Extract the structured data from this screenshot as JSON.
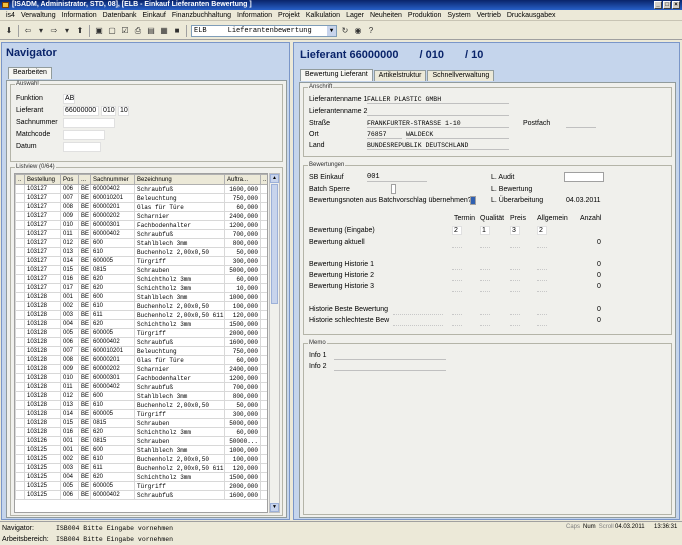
{
  "window": {
    "title": "[ISADM, Administrator, STD, 08], [ELB - Einkauf Lieferanten Bewertung ]"
  },
  "menu": [
    "is4",
    "Verwaltung",
    "Information",
    "Datenbank",
    "Einkauf",
    "Finanzbuchhaltung",
    "Information",
    "Projekt",
    "Kalkulation",
    "Lager",
    "Neuheiten",
    "Produktion",
    "System",
    "Vertrieb",
    "Druckausgabex"
  ],
  "toolbar": {
    "module_code": "ELB",
    "module_name": "Lieferantenbewertung"
  },
  "navigator": {
    "title": "Navigator",
    "tab": "Bearbeiten",
    "auswahl_label": "Auswahl",
    "fields": {
      "funktion_label": "Funktion",
      "funktion_value": "AB",
      "lieferant_label": "Lieferant",
      "lieferant_value": "66000000",
      "lieferant_pos": "010",
      "lieferant_seq": "10",
      "sachnummer_label": "Sachnummer",
      "matchcode_label": "Matchcode",
      "datum_label": "Datum"
    },
    "list_label": "Listview (0/64)",
    "columns": [
      "..",
      "Bestellung",
      "Pos",
      "...",
      "Sachnummer",
      "Bezeichnung",
      "Auftra...",
      ".."
    ],
    "rows": [
      [
        "103127",
        "006",
        "BE",
        "60000402",
        "Schraubfuß",
        "1600,000"
      ],
      [
        "103127",
        "007",
        "BE",
        "600010201",
        "Beleuchtung",
        "750,000"
      ],
      [
        "103127",
        "008",
        "BE",
        "60000201",
        "Glas für Türe",
        "60,000"
      ],
      [
        "103127",
        "009",
        "BE",
        "60000202",
        "Scharnier",
        "2400,000"
      ],
      [
        "103127",
        "010",
        "BE",
        "60000301",
        "Fachbodenhalter",
        "1200,000"
      ],
      [
        "103127",
        "011",
        "BE",
        "60000402",
        "Schraubfuß",
        "700,000"
      ],
      [
        "103127",
        "012",
        "BE",
        "600",
        "Stahlblech 3mm",
        "800,000"
      ],
      [
        "103127",
        "013",
        "BE",
        "610",
        "Buchenholz 2,00x0,50",
        "50,000"
      ],
      [
        "103127",
        "014",
        "BE",
        "600005",
        "Türgriff",
        "300,000"
      ],
      [
        "103127",
        "015",
        "BE",
        "0815",
        "Schrauben",
        "5000,000"
      ],
      [
        "103127",
        "016",
        "BE",
        "620",
        "Schichtholz 3mm",
        "60,000"
      ],
      [
        "103127",
        "017",
        "BE",
        "620",
        "Schichtholz 3mm",
        "10,000"
      ],
      [
        "103128",
        "001",
        "BE",
        "600",
        "Stahlblech 3mm",
        "1000,000"
      ],
      [
        "103128",
        "002",
        "BE",
        "610",
        "Buchenholz 2,00x0,50",
        "100,000"
      ],
      [
        "103128",
        "003",
        "BE",
        "611",
        "Buchenholz 2,00x0,50  611",
        "120,000"
      ],
      [
        "103128",
        "004",
        "BE",
        "620",
        "Schichtholz 3mm",
        "1500,000"
      ],
      [
        "103128",
        "005",
        "BE",
        "600005",
        "Türgriff",
        "2000,000"
      ],
      [
        "103128",
        "006",
        "BE",
        "60000402",
        "Schraubfuß",
        "1600,000"
      ],
      [
        "103128",
        "007",
        "BE",
        "600010201",
        "Beleuchtung",
        "750,000"
      ],
      [
        "103128",
        "008",
        "BE",
        "60000201",
        "Glas für Türe",
        "60,000"
      ],
      [
        "103128",
        "009",
        "BE",
        "60000202",
        "Scharnier",
        "2400,000"
      ],
      [
        "103128",
        "010",
        "BE",
        "60000301",
        "Fachbodenhalter",
        "1200,000"
      ],
      [
        "103128",
        "011",
        "BE",
        "60000402",
        "Schraubfuß",
        "700,000"
      ],
      [
        "103128",
        "012",
        "BE",
        "600",
        "Stahlblech 3mm",
        "800,000"
      ],
      [
        "103128",
        "013",
        "BE",
        "610",
        "Buchenholz 2,00x0,50",
        "50,000"
      ],
      [
        "103128",
        "014",
        "BE",
        "600005",
        "Türgriff",
        "300,000"
      ],
      [
        "103128",
        "015",
        "BE",
        "0815",
        "Schrauben",
        "5000,000"
      ],
      [
        "103128",
        "016",
        "BE",
        "620",
        "Schichtholz 3mm",
        "60,000"
      ],
      [
        "103126",
        "001",
        "BE",
        "0815",
        "Schrauben",
        "50000..."
      ],
      [
        "103125",
        "001",
        "BE",
        "600",
        "Stahlblech 3mm",
        "1000,000"
      ],
      [
        "103125",
        "002",
        "BE",
        "610",
        "Buchenholz 2,00x0,50",
        "100,000"
      ],
      [
        "103125",
        "003",
        "BE",
        "611",
        "Buchenholz 2,00x0,50  611",
        "120,000"
      ],
      [
        "103125",
        "004",
        "BE",
        "620",
        "Schichtholz 3mm",
        "1500,000"
      ],
      [
        "103125",
        "005",
        "BE",
        "600005",
        "Türgriff",
        "2000,000"
      ],
      [
        "103125",
        "006",
        "BE",
        "60000402",
        "Schraubfuß",
        "1600,000"
      ]
    ]
  },
  "detail": {
    "title": "Lieferant 66000000",
    "pos": "/ 010",
    "seq": "/ 10",
    "tabs": [
      "Bewertung Lieferant",
      "Artikelstruktur",
      "Schnellverwaltung"
    ],
    "anschrift": {
      "group_label": "Anschrift",
      "name1_label": "Lieferantenname 1",
      "name1_value": "FALLER PLASTIC GMBH",
      "name2_label": "Lieferantenname 2",
      "strasse_label": "Straße",
      "strasse_value": "FRANKFURTER-STRASSE 1-10",
      "postfach_label": "Postfach",
      "ort_label": "Ort",
      "plz_value": "76857",
      "ort_value": "WALDECK",
      "land_label": "Land",
      "land_value": "BUNDESREPUBLIK DEUTSCHLAND"
    },
    "bewertungen": {
      "group_label": "Bewertungen",
      "sb_label": "SB Einkauf",
      "sb_value": "001",
      "laudit_label": "L. Audit",
      "sperre_label": "Batch Sperre",
      "lbewertung_label": "L. Bewertung",
      "noten_label": "Bewertungsnoten aus Batchvorschlag übernehmen?",
      "lueber_label": "L. Überarbeitung",
      "lueber_value": "04.03.2011",
      "columns": [
        "Termin",
        "Qualität",
        "Preis",
        "Allgemein",
        "Anzahl"
      ],
      "eingabe_label": "Bewertung (Eingabe)",
      "eingabe_values": [
        "2",
        "1",
        "3",
        "2"
      ],
      "aktuell_label": "Bewertung aktuell",
      "aktuell_anzahl": "0",
      "h1_label": "Bewertung Historie 1",
      "h1_anzahl": "0",
      "h2_label": "Bewertung Historie 2",
      "h2_anzahl": "0",
      "h3_label": "Bewertung Historie 3",
      "h3_anzahl": "0",
      "beste_label": "Historie Beste Bewertung",
      "beste_anzahl": "0",
      "schlecht_label": "Historie schlechteste Bew",
      "schlecht_anzahl": "0"
    },
    "memo": {
      "group_label": "Memo",
      "info1_label": "Info 1",
      "info2_label": "Info 2"
    }
  },
  "status": {
    "navigator_label": "Navigator:",
    "navigator_msg": "ISB004 Bitte Eingabe vornehmen",
    "arbeit_label": "Arbeitsbereich:",
    "arbeit_msg": "ISB004 Bitte Eingabe vornehmen",
    "caps": "Caps",
    "num": "Num",
    "scroll": "Scroll",
    "date": "04.03.2011",
    "time": "13:36:31"
  }
}
